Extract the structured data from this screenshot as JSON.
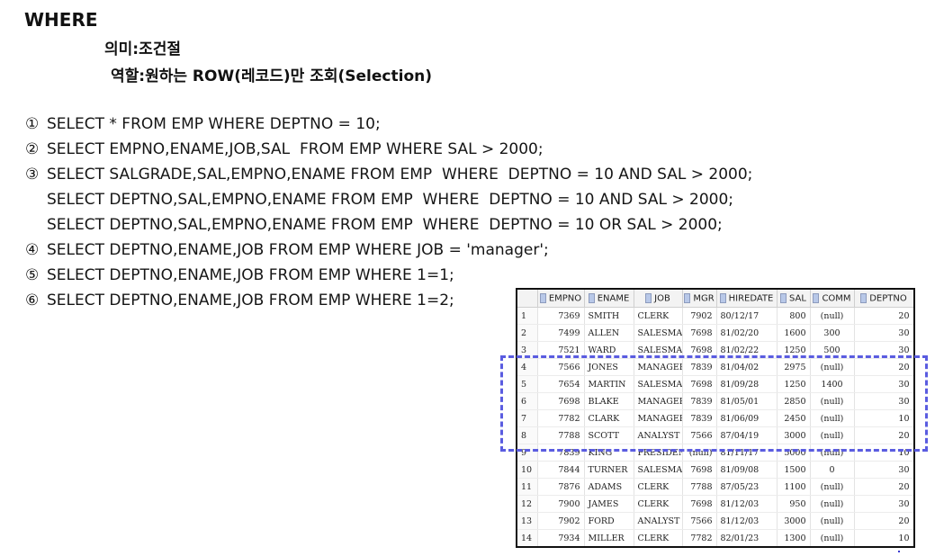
{
  "heading": "WHERE",
  "meaning": "의미:조건절",
  "role": "역할:원하는 ROW(레코드)만 조회(Selection)",
  "queries": [
    {
      "num": "①",
      "text": "SELECT * FROM EMP WHERE DEPTNO = 10;"
    },
    {
      "num": "②",
      "text": "SELECT EMPNO,ENAME,JOB,SAL  FROM EMP WHERE SAL > 2000;"
    },
    {
      "num": "③",
      "text": "SELECT SALGRADE,SAL,EMPNO,ENAME FROM EMP  WHERE  DEPTNO = 10 AND SAL > 2000;"
    },
    {
      "num": "",
      "text": "SELECT DEPTNO,SAL,EMPNO,ENAME FROM EMP  WHERE  DEPTNO = 10 AND SAL > 2000;"
    },
    {
      "num": "",
      "text": "SELECT DEPTNO,SAL,EMPNO,ENAME FROM EMP  WHERE  DEPTNO = 10 OR SAL > 2000;"
    },
    {
      "num": "④",
      "text": "SELECT DEPTNO,ENAME,JOB FROM EMP WHERE JOB = 'manager';"
    },
    {
      "num": "⑤",
      "text": "SELECT DEPTNO,ENAME,JOB FROM EMP WHERE 1=1;"
    },
    {
      "num": "⑥",
      "text": "SELECT DEPTNO,ENAME,JOB FROM EMP WHERE 1=2;"
    }
  ],
  "result_grid": {
    "columns": [
      "",
      "EMPNO",
      "ENAME",
      "JOB",
      "MGR",
      "HIREDATE",
      "SAL",
      "COMM",
      "DEPTNO"
    ],
    "rows": [
      [
        "1",
        "7369",
        "SMITH",
        "CLERK",
        "7902",
        "80/12/17",
        "800",
        "(null)",
        "20"
      ],
      [
        "2",
        "7499",
        "ALLEN",
        "SALESMAN",
        "7698",
        "81/02/20",
        "1600",
        "300",
        "30"
      ],
      [
        "3",
        "7521",
        "WARD",
        "SALESMAN",
        "7698",
        "81/02/22",
        "1250",
        "500",
        "30"
      ],
      [
        "4",
        "7566",
        "JONES",
        "MANAGER",
        "7839",
        "81/04/02",
        "2975",
        "(null)",
        "20"
      ],
      [
        "5",
        "7654",
        "MARTIN",
        "SALESMAN",
        "7698",
        "81/09/28",
        "1250",
        "1400",
        "30"
      ],
      [
        "6",
        "7698",
        "BLAKE",
        "MANAGER",
        "7839",
        "81/05/01",
        "2850",
        "(null)",
        "30"
      ],
      [
        "7",
        "7782",
        "CLARK",
        "MANAGER",
        "7839",
        "81/06/09",
        "2450",
        "(null)",
        "10"
      ],
      [
        "8",
        "7788",
        "SCOTT",
        "ANALYST",
        "7566",
        "87/04/19",
        "3000",
        "(null)",
        "20"
      ],
      [
        "9",
        "7839",
        "KING",
        "PRESIDENT",
        "(null)",
        "81/11/17",
        "5000",
        "(null)",
        "10"
      ],
      [
        "10",
        "7844",
        "TURNER",
        "SALESMAN",
        "7698",
        "81/09/08",
        "1500",
        "0",
        "30"
      ],
      [
        "11",
        "7876",
        "ADAMS",
        "CLERK",
        "7788",
        "87/05/23",
        "1100",
        "(null)",
        "20"
      ],
      [
        "12",
        "7900",
        "JAMES",
        "CLERK",
        "7698",
        "81/12/03",
        "950",
        "(null)",
        "30"
      ],
      [
        "13",
        "7902",
        "FORD",
        "ANALYST",
        "7566",
        "81/12/03",
        "3000",
        "(null)",
        "20"
      ],
      [
        "14",
        "7934",
        "MILLER",
        "CLERK",
        "7782",
        "82/01/23",
        "1300",
        "(null)",
        "10"
      ]
    ]
  },
  "colors": {
    "highlight": "#5a5ce0"
  }
}
